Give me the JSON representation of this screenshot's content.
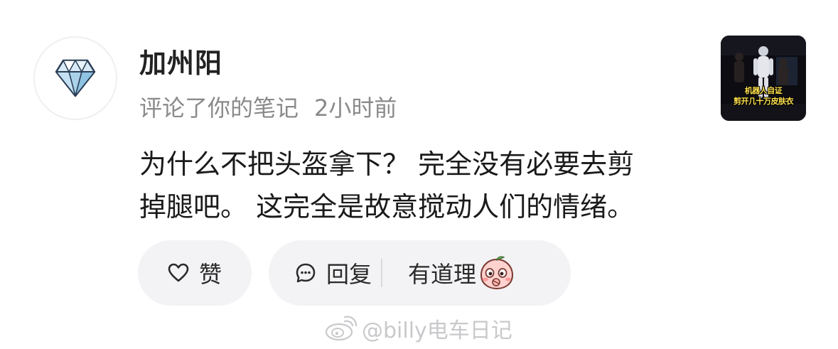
{
  "comment_card": {
    "username": "加州阳",
    "action_text": "评论了你的笔记",
    "time": "2小时前",
    "comment_lines": [
      "为什么不把头盔拿下？ 完全没有必要去剪",
      "掉腿吧。 这完全是故意搅动人们的情绪。"
    ],
    "avatar_icon": "diamond-icon",
    "thumbnail": {
      "caption_lines": [
        "机器人自证",
        "剪开几十万皮肤衣"
      ]
    }
  },
  "actions": {
    "like_label": "赞",
    "reply_label": "回复",
    "agree_label": "有道理",
    "like_icon": "heart-outline-icon",
    "reply_icon": "chat-bubble-icon",
    "agree_icon": "peach-face-emoji-icon"
  },
  "watermark": {
    "text": "@billy电车日记",
    "icon": "weibo-logo-icon"
  },
  "colors": {
    "background": "#ffffff",
    "pill_background": "#f3f3f5",
    "username": "#222222",
    "meta_text": "#8a8a8a",
    "comment_text": "#1a1a1a",
    "watermark": "#c9c9cc"
  }
}
